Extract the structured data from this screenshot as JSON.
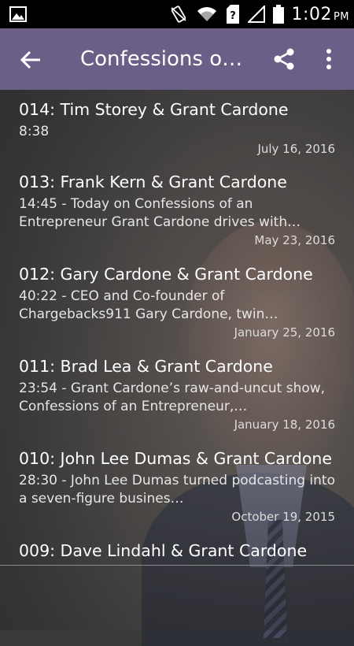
{
  "status_bar": {
    "time": "1:02",
    "ampm": "PM",
    "icons": [
      "image-icon",
      "vibrate-icon",
      "wifi-icon",
      "sim-unknown-icon",
      "signal-icon",
      "battery-icon"
    ]
  },
  "toolbar": {
    "title": "Confessions of…",
    "back_icon": "arrow-back-icon",
    "share_icon": "share-icon",
    "more_icon": "more-vert-icon",
    "color": "#6b5f87"
  },
  "episodes": [
    {
      "title": "014: Tim Storey & Grant Cardone",
      "desc": "8:38",
      "date": "July 16, 2016"
    },
    {
      "title": "013: Frank Kern & Grant Cardone",
      "desc": "14:45 - Today on Confessions of an Entrepreneur Grant Cardone drives with…",
      "date": "May 23, 2016"
    },
    {
      "title": "012: Gary Cardone & Grant Cardone",
      "desc": "40:22 - CEO and Co-founder of Chargebacks911 Gary Cardone, twin…",
      "date": "January 25, 2016"
    },
    {
      "title": "011: Brad Lea & Grant Cardone",
      "desc": "23:54 - Grant Cardone’s raw-and-uncut show, Confessions of an Entrepreneur,…",
      "date": "January 18, 2016"
    },
    {
      "title": "010: John Lee Dumas & Grant Cardone",
      "desc": "28:30 - John Lee Dumas turned podcasting into a seven-figure busines…",
      "date": "October 19, 2015"
    },
    {
      "title": "009: Dave Lindahl & Grant Cardone"
    }
  ]
}
